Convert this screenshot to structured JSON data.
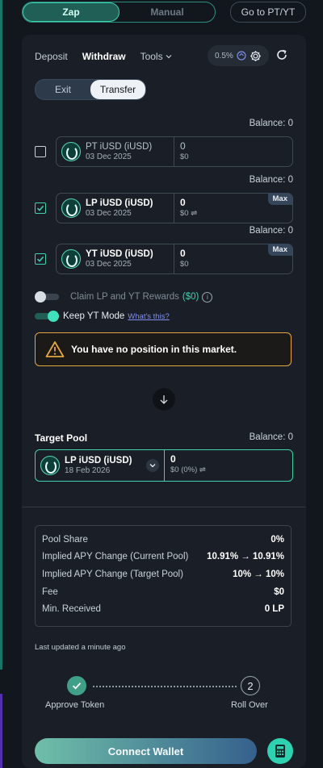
{
  "modes": {
    "zap": "Zap",
    "manual": "Manual"
  },
  "goto_label": "Go to PT/YT",
  "tabs": {
    "deposit": "Deposit",
    "withdraw": "Withdraw",
    "tools": "Tools"
  },
  "slippage": "0.5%",
  "segment": {
    "exit": "Exit",
    "transfer": "Transfer"
  },
  "assets": [
    {
      "name": "PT iUSD (iUSD)",
      "date": "03 Dec 2025",
      "amount": "0",
      "usd": "$0",
      "balance": "Balance: 0",
      "checked": false,
      "max": ""
    },
    {
      "name": "LP iUSD (iUSD)",
      "date": "03 Dec 2025",
      "amount": "0",
      "usd": "$0 ⇌",
      "balance": "Balance: 0",
      "checked": true,
      "max": "Max"
    },
    {
      "name": "YT iUSD (iUSD)",
      "date": "03 Dec 2025",
      "amount": "0",
      "usd": "$0",
      "balance": "Balance: 0",
      "checked": true,
      "max": "Max"
    }
  ],
  "claim": {
    "label": "Claim LP and YT Rewards",
    "value": "($0)"
  },
  "keep_yt": {
    "label": "Keep YT Mode",
    "link": "What's this?"
  },
  "warning": "You have no position in this market.",
  "target": {
    "label": "Target Pool",
    "balance": "Balance: 0",
    "name": "LP iUSD (iUSD)",
    "date": "18 Feb 2026",
    "amount": "0",
    "usd": "$0 (0%)  ⇌"
  },
  "stats": [
    {
      "label": "Pool Share",
      "value": "0%"
    },
    {
      "label": "Implied APY Change (Current Pool)",
      "value": "10.91% → 10.91%"
    },
    {
      "label": "Implied APY Change (Target Pool)",
      "value": "10% → 10%"
    },
    {
      "label": "Fee",
      "value": "$0"
    },
    {
      "label": "Min. Received",
      "value": "0 LP"
    }
  ],
  "updated": "Last updated a minute ago",
  "steps": {
    "step1": "Approve Token",
    "step2_num": "2",
    "step2": "Roll Over"
  },
  "connect_label": "Connect Wallet",
  "colors": {
    "accent": "#3fd1b1",
    "warning": "#e3a640",
    "background": "#12161d",
    "card": "#1a1f27"
  }
}
